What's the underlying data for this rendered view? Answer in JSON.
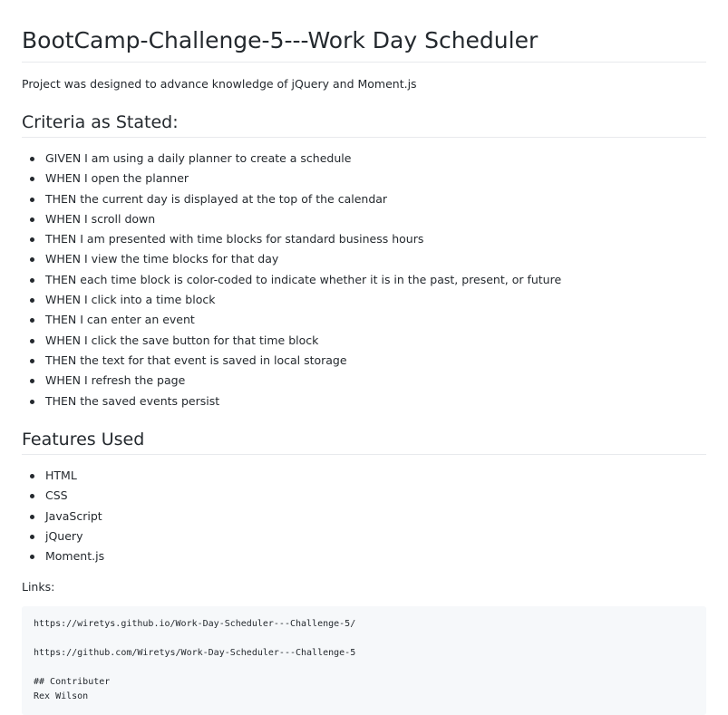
{
  "title": "BootCamp-Challenge-5---Work Day Scheduler",
  "intro": "Project was designed to advance knowledge of jQuery and Moment.js",
  "criteria": {
    "heading": "Criteria as Stated:",
    "items": [
      "GIVEN I am using a daily planner to create a schedule",
      "WHEN I open the planner",
      "THEN the current day is displayed at the top of the calendar",
      "WHEN I scroll down",
      "THEN I am presented with time blocks for standard business hours",
      "WHEN I view the time blocks for that day",
      "THEN each time block is color-coded to indicate whether it is in the past, present, or future",
      "WHEN I click into a time block",
      "THEN I can enter an event",
      "WHEN I click the save button for that time block",
      "THEN the text for that event is saved in local storage",
      "WHEN I refresh the page",
      "THEN the saved events persist"
    ]
  },
  "features": {
    "heading": "Features Used",
    "items": [
      "HTML",
      "CSS",
      "JavaScript",
      "jQuery",
      "Moment.js"
    ]
  },
  "links_label": "Links:",
  "code_lines": [
    "https://wiretys.github.io/Work-Day-Scheduler---Challenge-5/",
    "https://github.com/Wiretys/Work-Day-Scheduler---Challenge-5",
    "## Contributer",
    "Rex Wilson"
  ],
  "colors": {
    "text": "#24292e",
    "rule": "#e8eaed",
    "code_background": "#f6f8fa"
  }
}
